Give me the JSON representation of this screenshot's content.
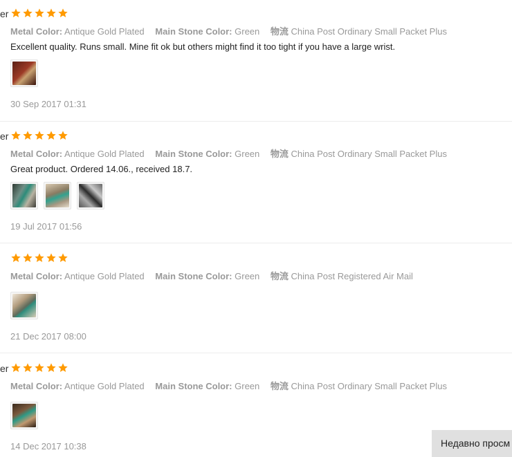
{
  "reviews": [
    {
      "name_fragment": "er",
      "rating": 5,
      "props": [
        {
          "key": "Metal Color:",
          "value": "Antique Gold Plated"
        },
        {
          "key": "Main Stone Color:",
          "value": "Green"
        },
        {
          "key": "物流",
          "value": "China Post Ordinary Small Packet Plus"
        }
      ],
      "text": "Excellent quality. Runs small. Mine fit ok but others might find it too tight if you have a large wrist.",
      "date": "30 Sep 2017 01:31"
    },
    {
      "name_fragment": "er",
      "rating": 5,
      "props": [
        {
          "key": "Metal Color:",
          "value": "Antique Gold Plated"
        },
        {
          "key": "Main Stone Color:",
          "value": "Green"
        },
        {
          "key": "物流",
          "value": "China Post Ordinary Small Packet Plus"
        }
      ],
      "text": "Great product. Ordered 14.06., received 18.7.",
      "date": "19 Jul 2017 01:56"
    },
    {
      "name_fragment": "",
      "rating": 5,
      "props": [
        {
          "key": "Metal Color:",
          "value": "Antique Gold Plated"
        },
        {
          "key": "Main Stone Color:",
          "value": "Green"
        },
        {
          "key": "物流",
          "value": "China Post Registered Air Mail"
        }
      ],
      "text": "",
      "date": "21 Dec 2017 08:00"
    },
    {
      "name_fragment": "er",
      "rating": 5,
      "props": [
        {
          "key": "Metal Color:",
          "value": "Antique Gold Plated"
        },
        {
          "key": "Main Stone Color:",
          "value": "Green"
        },
        {
          "key": "物流",
          "value": "China Post Ordinary Small Packet Plus"
        }
      ],
      "text": "",
      "date": "14 Dec 2017 10:38"
    }
  ],
  "recently_viewed_label": "Недавно просм",
  "colors": {
    "star": "#ff9a00",
    "muted": "#999999",
    "text": "#222222"
  }
}
